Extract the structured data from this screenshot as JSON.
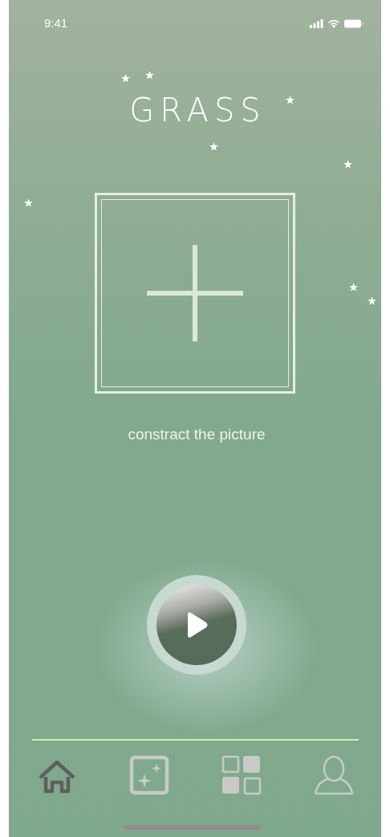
{
  "status_bar": {
    "time": "9:41"
  },
  "title": "GRASS",
  "image_slot": {
    "caption": "constract the picture"
  },
  "tab_bar": [
    {
      "kind": "home",
      "selected": true
    },
    {
      "kind": "sparkle",
      "selected": false
    },
    {
      "kind": "grid",
      "selected": false
    },
    {
      "kind": "profile",
      "selected": false
    }
  ]
}
